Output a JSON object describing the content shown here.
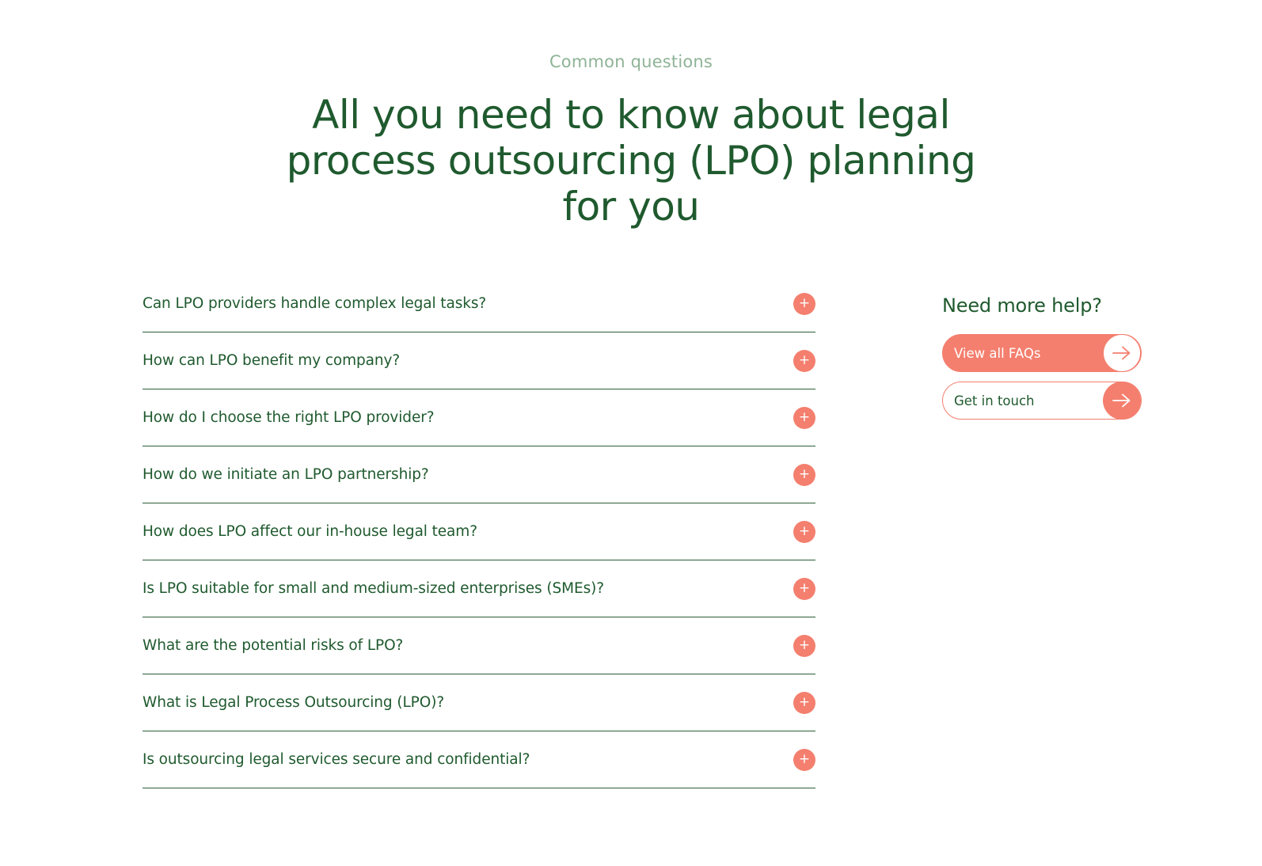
{
  "section": {
    "eyebrow": "Common questions",
    "headline": "All you need to know about legal process outsourcing (LPO) planning for you"
  },
  "faq": {
    "expand_icon": "plus-icon",
    "items": [
      {
        "question": "Can LPO providers handle complex legal tasks?"
      },
      {
        "question": "How can LPO benefit my company?"
      },
      {
        "question": "How do I choose the right LPO provider?"
      },
      {
        "question": "How do we initiate an LPO partnership?"
      },
      {
        "question": "How does LPO affect our in-house legal team?"
      },
      {
        "question": "Is LPO suitable for small and medium-sized enterprises (SMEs)?"
      },
      {
        "question": "What are the potential risks of LPO?"
      },
      {
        "question": "What is Legal Process Outsourcing (LPO)?"
      },
      {
        "question": "Is outsourcing legal services secure and confidential?"
      }
    ]
  },
  "help": {
    "title": "Need more help?",
    "view_all_label": "View all FAQs",
    "get_in_touch_label": "Get in touch",
    "arrow_icon": "arrow-right-icon"
  },
  "colors": {
    "brand_green": "#1f5a2e",
    "eyebrow_green": "#8fb396",
    "accent_coral": "#f47f6e",
    "divider": "#2a5e38"
  }
}
